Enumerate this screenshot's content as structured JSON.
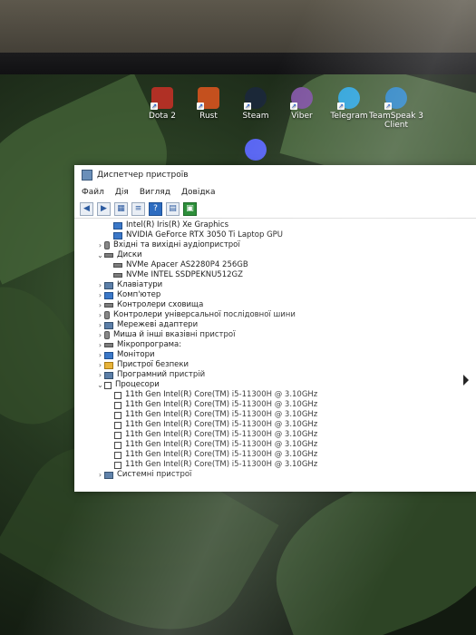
{
  "desktop": {
    "icons": [
      {
        "label": "Dota 2",
        "icon": "dota2-icon",
        "color": "#c0392b"
      },
      {
        "label": "Rust",
        "icon": "rust-icon",
        "color": "#d35400"
      },
      {
        "label": "Steam",
        "icon": "steam-icon",
        "color": "#1b2838"
      },
      {
        "label": "Viber",
        "icon": "viber-icon",
        "color": "#7b519d"
      },
      {
        "label": "Telegram",
        "icon": "telegram-icon",
        "color": "#2aa1da"
      },
      {
        "label": "TeamSpeak 3 Client",
        "icon": "teamspeak-icon",
        "color": "#2580c3"
      },
      {
        "label": "",
        "icon": "discord-icon",
        "color": "#5865f2"
      }
    ]
  },
  "window": {
    "title": "Диспетчер пристроїв",
    "menu": [
      "Файл",
      "Дія",
      "Вигляд",
      "Довідка"
    ],
    "toolbar": [
      "back-icon",
      "forward-icon",
      "properties-icon",
      "list-icon",
      "help-icon",
      "scan-icon",
      "monitor-icon"
    ],
    "tree": [
      {
        "label": "Intel(R) Iris(R) Xe Graphics",
        "level": 2,
        "icon": "display-adapter-icon"
      },
      {
        "label": "NVIDIA GeForce RTX 3050 Ti Laptop GPU",
        "level": 2,
        "icon": "display-adapter-icon"
      },
      {
        "label": "Вхідні та вихідні аудіопристрої",
        "level": 1,
        "icon": "audio-icon",
        "expander": ">"
      },
      {
        "label": "Диски",
        "level": 1,
        "icon": "disk-icon",
        "expander": "v"
      },
      {
        "label": "NVMe Apacer AS2280P4 256GB",
        "level": 2,
        "icon": "disk-icon"
      },
      {
        "label": "NVMe INTEL SSDPEKNU512GZ",
        "level": 2,
        "icon": "disk-icon"
      },
      {
        "label": "Клавіатури",
        "level": 1,
        "icon": "keyboard-icon",
        "expander": ">"
      },
      {
        "label": "Комп'ютер",
        "level": 1,
        "icon": "computer-icon",
        "expander": ">"
      },
      {
        "label": "Контролери сховища",
        "level": 1,
        "icon": "storage-controller-icon",
        "expander": ">"
      },
      {
        "label": "Контролери універсальної послідовної шини",
        "level": 1,
        "icon": "usb-icon",
        "expander": ">"
      },
      {
        "label": "Мережеві адаптери",
        "level": 1,
        "icon": "network-icon",
        "expander": ">"
      },
      {
        "label": "Миша й інші вказівні пристрої",
        "level": 1,
        "icon": "mouse-icon",
        "expander": ">"
      },
      {
        "label": "Мікропрограма:",
        "level": 1,
        "icon": "firmware-icon",
        "expander": ">"
      },
      {
        "label": "Монітори",
        "level": 1,
        "icon": "monitor-icon",
        "expander": ">"
      },
      {
        "label": "Пристрої безпеки",
        "level": 1,
        "icon": "security-icon",
        "expander": ">"
      },
      {
        "label": "Програмний пристрій",
        "level": 1,
        "icon": "software-device-icon",
        "expander": ">"
      },
      {
        "label": "Процесори",
        "level": 1,
        "icon": "processor-icon",
        "expander": "v"
      },
      {
        "label": "11th Gen Intel(R) Core(TM) i5-11300H @ 3.10GHz",
        "level": 3,
        "icon": "processor-icon"
      },
      {
        "label": "11th Gen Intel(R) Core(TM) i5-11300H @ 3.10GHz",
        "level": 3,
        "icon": "processor-icon"
      },
      {
        "label": "11th Gen Intel(R) Core(TM) i5-11300H @ 3.10GHz",
        "level": 3,
        "icon": "processor-icon"
      },
      {
        "label": "11th Gen Intel(R) Core(TM) i5-11300H @ 3.10GHz",
        "level": 3,
        "icon": "processor-icon"
      },
      {
        "label": "11th Gen Intel(R) Core(TM) i5-11300H @ 3.10GHz",
        "level": 3,
        "icon": "processor-icon"
      },
      {
        "label": "11th Gen Intel(R) Core(TM) i5-11300H @ 3.10GHz",
        "level": 3,
        "icon": "processor-icon"
      },
      {
        "label": "11th Gen Intel(R) Core(TM) i5-11300H @ 3.10GHz",
        "level": 3,
        "icon": "processor-icon"
      },
      {
        "label": "11th Gen Intel(R) Core(TM) i5-11300H @ 3.10GHz",
        "level": 3,
        "icon": "processor-icon"
      },
      {
        "label": "Системні пристрої",
        "level": 1,
        "icon": "system-device-icon",
        "expander": ">"
      }
    ]
  }
}
